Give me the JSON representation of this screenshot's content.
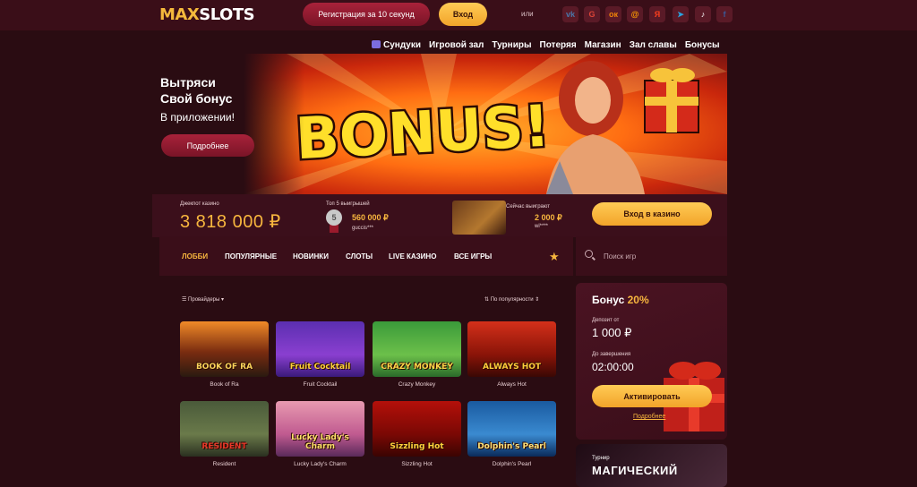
{
  "header": {
    "logo_max": "MAX",
    "logo_slots": "SLOTS",
    "register_label": "Регистрация за 10 секунд",
    "login_label": "Вход",
    "or_label": "или",
    "socials": [
      {
        "icon": "vk-icon",
        "glyph": "vk",
        "color": "#4a76a8"
      },
      {
        "icon": "google-icon",
        "glyph": "G",
        "color": "#db4437"
      },
      {
        "icon": "odnoklassniki-icon",
        "glyph": "ок",
        "color": "#ee8208"
      },
      {
        "icon": "mailru-icon",
        "glyph": "@",
        "color": "#ff9e00"
      },
      {
        "icon": "yandex-icon",
        "glyph": "Я",
        "color": "#fc3f1d"
      },
      {
        "icon": "telegram-icon",
        "glyph": "➤",
        "color": "#2aa3df"
      },
      {
        "icon": "tiktok-icon",
        "glyph": "♪",
        "color": "#ffffff"
      },
      {
        "icon": "facebook-icon",
        "glyph": "f",
        "color": "#3b5998"
      }
    ]
  },
  "nav": {
    "items": [
      "Сундуки",
      "Игровой зал",
      "Турниры",
      "Потеряя",
      "Магазин",
      "Зал славы",
      "Бонусы"
    ]
  },
  "promo": {
    "line1": "Вытряси",
    "line2": "Свой бонус",
    "line3": "В приложении!",
    "button": "Подробнее",
    "banner_text": "BONUS!"
  },
  "jackpot": {
    "label": "Джекпот казино",
    "value": "3 818 000 ₽"
  },
  "top_wins": {
    "label": "Топ 5 выигрышей",
    "place": "5",
    "amount": "560 000 ₽",
    "user": "guccis***"
  },
  "current_win": {
    "label": "Сейчас выиграют",
    "amount": "2 000 ₽",
    "user": "wi****"
  },
  "enter_casino_label": "Вход в казино",
  "tabs": {
    "items": [
      "ЛОББИ",
      "ПОПУЛЯРНЫЕ",
      "НОВИНКИ",
      "СЛОТЫ",
      "LIVE КАЗИНО",
      "ВСЕ ИГРЫ"
    ],
    "active": "ЛОББИ"
  },
  "search": {
    "placeholder": "Поиск игр"
  },
  "filters": {
    "providers": "Провайдеры",
    "sort": "По популярности"
  },
  "games": [
    {
      "name": "Book of Ra",
      "logo": "BOOK OF RA",
      "bg": "linear-gradient(180deg,#f08a28 0%,#7a2c10 55%,#2a1a10 100%)",
      "fg": "#f9d35a"
    },
    {
      "name": "Fruit Cocktail",
      "logo": "Fruit Cocktail",
      "bg": "linear-gradient(180deg,#5b2fb0 0%,#8a3fd0 60%,#3a1a7a 100%)",
      "fg": "#ffd23c"
    },
    {
      "name": "Crazy Monkey",
      "logo": "CRAZY MONKEY",
      "bg": "linear-gradient(180deg,#3a9a3a 0%,#6cc04a 60%,#2a6a2a 100%)",
      "fg": "#ffd84a"
    },
    {
      "name": "Always Hot",
      "logo": "ALWAYS HOT",
      "bg": "linear-gradient(180deg,#d4301a 0%,#8a1408 60%,#3a0804 100%)",
      "fg": "#ffcd3a"
    },
    {
      "name": "Resident",
      "logo": "RESIDENT",
      "bg": "linear-gradient(180deg,#4a5a3a 0%,#6a7a4a 60%,#2a3020 100%)",
      "fg": "#e83a2a"
    },
    {
      "name": "Lucky Lady's Charm",
      "logo": "Lucky Lady's Charm",
      "bg": "linear-gradient(180deg,#e89ab0 0%,#c05a90 60%,#5a2a5a 100%)",
      "fg": "#ffe06a"
    },
    {
      "name": "Sizzling Hot",
      "logo": "Sizzling Hot",
      "bg": "linear-gradient(180deg,#b4100a 0%,#7a0804 60%,#3a0402 100%)",
      "fg": "#ffd23c"
    },
    {
      "name": "Dolphin's Pearl",
      "logo": "Dolphin's Pearl",
      "bg": "linear-gradient(180deg,#1a5aa0 0%,#3a8ad0 60%,#0a2a5a 100%)",
      "fg": "#ffe27a"
    }
  ],
  "bonus": {
    "title": "Бонус",
    "percent": "20%",
    "deposit_label": "Депозит от",
    "deposit_value": "1 000 ₽",
    "timer_label": "До завершения",
    "timer_value": "02:00:00",
    "activate": "Активировать",
    "details": "Подробнее"
  },
  "tournament": {
    "label": "Турнир",
    "title": "МАГИЧЕСКИЙ"
  },
  "colors": {
    "accent": "#f7b63e",
    "primary_button": "#a8223a",
    "background": "#2a0c12"
  }
}
